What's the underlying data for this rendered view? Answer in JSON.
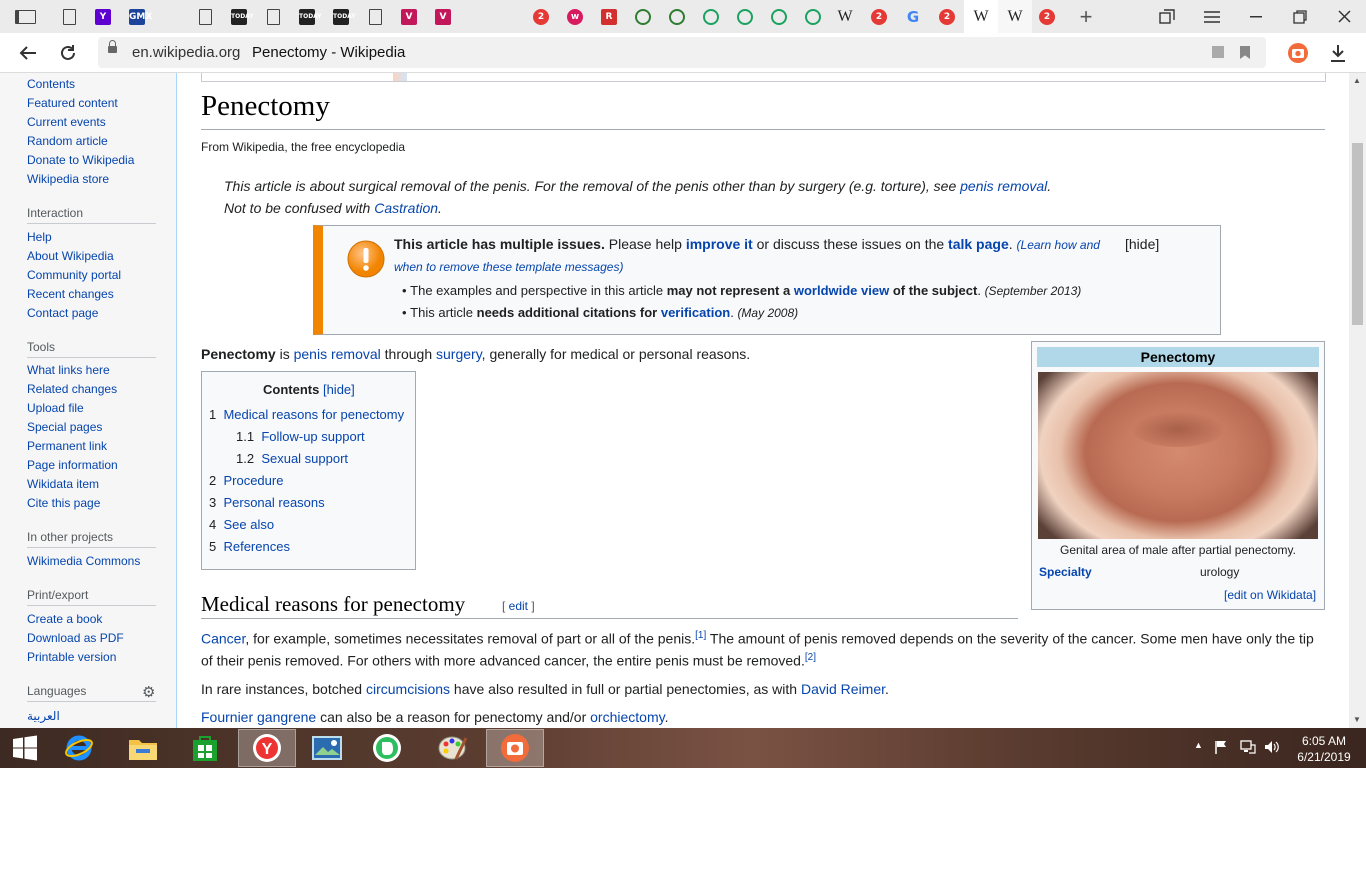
{
  "browser": {
    "tabs": [
      {
        "icon": "sidebar-toggle-icon",
        "label": "",
        "color": "#444"
      },
      {
        "icon": "document-icon",
        "label": "",
        "color": "#444"
      },
      {
        "icon": "yahoo-icon",
        "label": "Y",
        "color": "#5f01d1"
      },
      {
        "icon": "gmx-icon",
        "label": "GMX",
        "color": "#1c449b"
      },
      {
        "icon": "twitter-icon",
        "label": "",
        "color": "#1da1f2"
      },
      {
        "icon": "document-icon",
        "label": "",
        "color": "#444"
      },
      {
        "icon": "today-icon",
        "label": "TODAY",
        "color": "#222"
      },
      {
        "icon": "document-icon",
        "label": "",
        "color": "#444"
      },
      {
        "icon": "today-icon",
        "label": "TODAY",
        "color": "#222"
      },
      {
        "icon": "today-icon",
        "label": "TODAY",
        "color": "#222"
      },
      {
        "icon": "document-icon",
        "label": "",
        "color": "#444"
      },
      {
        "icon": "vivino-icon",
        "label": "V",
        "color": "#c2185b"
      },
      {
        "icon": "vivino-icon",
        "label": "V",
        "color": "#c2185b"
      },
      {
        "icon": "twitter-icon",
        "label": "",
        "color": "#1da1f2"
      },
      {
        "icon": "twitter-icon",
        "label": "",
        "color": "#1da1f2"
      },
      {
        "icon": "news-icon",
        "label": "2",
        "color": "#e53935"
      },
      {
        "icon": "w-icon",
        "label": "w",
        "color": "#d81b60"
      },
      {
        "icon": "r-icon",
        "label": "R",
        "color": "#d32f2f"
      },
      {
        "icon": "frog-icon",
        "label": "",
        "color": "#2e7d32"
      },
      {
        "icon": "frog-icon",
        "label": "",
        "color": "#2e7d32"
      },
      {
        "icon": "heart-icon",
        "label": "",
        "color": "#1aa260"
      },
      {
        "icon": "heart-icon",
        "label": "",
        "color": "#1aa260"
      },
      {
        "icon": "heart-icon",
        "label": "",
        "color": "#1aa260"
      },
      {
        "icon": "heart-icon",
        "label": "",
        "color": "#1aa260"
      },
      {
        "icon": "wikipedia-icon",
        "label": "W",
        "color": "#222"
      },
      {
        "icon": "news-icon",
        "label": "2",
        "color": "#e53935"
      },
      {
        "icon": "google-icon",
        "label": "G",
        "color": "#4285f4"
      },
      {
        "icon": "news-icon",
        "label": "2",
        "color": "#e53935"
      },
      {
        "icon": "wikipedia-icon",
        "label": "W",
        "color": "#222"
      },
      {
        "icon": "wikipedia-icon",
        "label": "W",
        "color": "#222"
      },
      {
        "icon": "news-icon",
        "label": "2",
        "color": "#e53935"
      }
    ],
    "domain": "en.wikipedia.org",
    "page_title": "Penectomy - Wikipedia"
  },
  "sidebar": {
    "nav": [
      "Contents",
      "Featured content",
      "Current events",
      "Random article",
      "Donate to Wikipedia",
      "Wikipedia store"
    ],
    "interaction_heading": "Interaction",
    "interaction": [
      "Help",
      "About Wikipedia",
      "Community portal",
      "Recent changes",
      "Contact page"
    ],
    "tools_heading": "Tools",
    "tools": [
      "What links here",
      "Related changes",
      "Upload file",
      "Special pages",
      "Permanent link",
      "Page information",
      "Wikidata item",
      "Cite this page"
    ],
    "projects_heading": "In other projects",
    "projects": [
      "Wikimedia Commons"
    ],
    "print_heading": "Print/export",
    "print": [
      "Create a book",
      "Download as PDF",
      "Printable version"
    ],
    "languages_heading": "Languages",
    "languages": [
      "العربية"
    ]
  },
  "article": {
    "title": "Penectomy",
    "tagline": "From Wikipedia, the free encyclopedia",
    "hatnote1_text": "This article is about surgical removal of the penis. For the removal of the penis other than by surgery (e.g. torture), see ",
    "hatnote1_link": "penis removal",
    "hatnote1_end": ".",
    "hatnote2_text": "Not to be confused with ",
    "hatnote2_link": "Castration",
    "hatnote2_end": ".",
    "issues": {
      "bold": "This article has multiple issues.",
      "t1": " Please help ",
      "improve": "improve it",
      "t2": " or discuss these issues on the ",
      "talk": "talk page",
      "t3": ". ",
      "learn": "(Learn how and",
      "learn2": "when to remove these template messages)",
      "hide": "[hide]",
      "b1_a": "The examples and perspective in this article ",
      "b1_b": "may not represent a ",
      "b1_link": "worldwide view",
      "b1_c": " of the subject",
      "b1_d": ". ",
      "b1_date": "(September 2013)",
      "b2_a": "This article ",
      "b2_b": "needs additional citations for ",
      "b2_link": "verification",
      "b2_c": ". ",
      "b2_date": "(May 2008)"
    },
    "lead_bold": "Penectomy",
    "lead_is": " is ",
    "lead_link1": "penis removal",
    "lead_through": " through ",
    "lead_link2": "surgery",
    "lead_end": ", generally for medical or personal reasons.",
    "toc": {
      "title": "Contents",
      "hide": "[hide]",
      "items": [
        {
          "num": "1",
          "label": "Medical reasons for penectomy"
        },
        {
          "num": "1.1",
          "label": "Follow-up support"
        },
        {
          "num": "1.2",
          "label": "Sexual support"
        },
        {
          "num": "2",
          "label": "Procedure"
        },
        {
          "num": "3",
          "label": "Personal reasons"
        },
        {
          "num": "4",
          "label": "See also"
        },
        {
          "num": "5",
          "label": "References"
        }
      ]
    },
    "infobox": {
      "title": "Penectomy",
      "caption": "Genital area of male after partial penectomy.",
      "specialty_label": "Specialty",
      "specialty_value": "urology",
      "edit_wikidata": "[edit on Wikidata]"
    },
    "section1": {
      "heading": "Medical reasons for penectomy",
      "edit_open": "[ ",
      "edit": "edit",
      "edit_close": " ]",
      "p1_link": "Cancer",
      "p1_text": ", for example, sometimes necessitates removal of part or all of the penis.",
      "p1_ref1": "[1]",
      "p1_text2": " The amount of penis removed depends on the severity of the cancer. Some men have only the tip",
      "p1_line2": "of their penis removed. For others with more advanced cancer, the entire penis must be removed.",
      "p1_ref2": "[2]",
      "p2_text": "In rare instances, botched ",
      "p2_link1": "circumcisions",
      "p2_text2": " have also resulted in full or partial penectomies, as with ",
      "p2_link2": "David Reimer",
      "p2_end": ".",
      "p3_link1": "Fournier gangrene",
      "p3_text": " can also be a reason for penectomy and/or ",
      "p3_link2": "orchiectomy",
      "p3_end": "."
    }
  },
  "taskbar": {
    "apps": [
      "start-icon",
      "internet-explorer-icon",
      "file-explorer-icon",
      "store-icon",
      "yandex-browser-icon",
      "photos-icon",
      "evernote-icon",
      "paint-icon",
      "camera-icon"
    ],
    "time": "6:05 AM",
    "date": "6/21/2019"
  },
  "colors": {
    "link": "#0645ad",
    "issue_bar": "#f28500",
    "infobox_header": "#b0d8e8"
  }
}
